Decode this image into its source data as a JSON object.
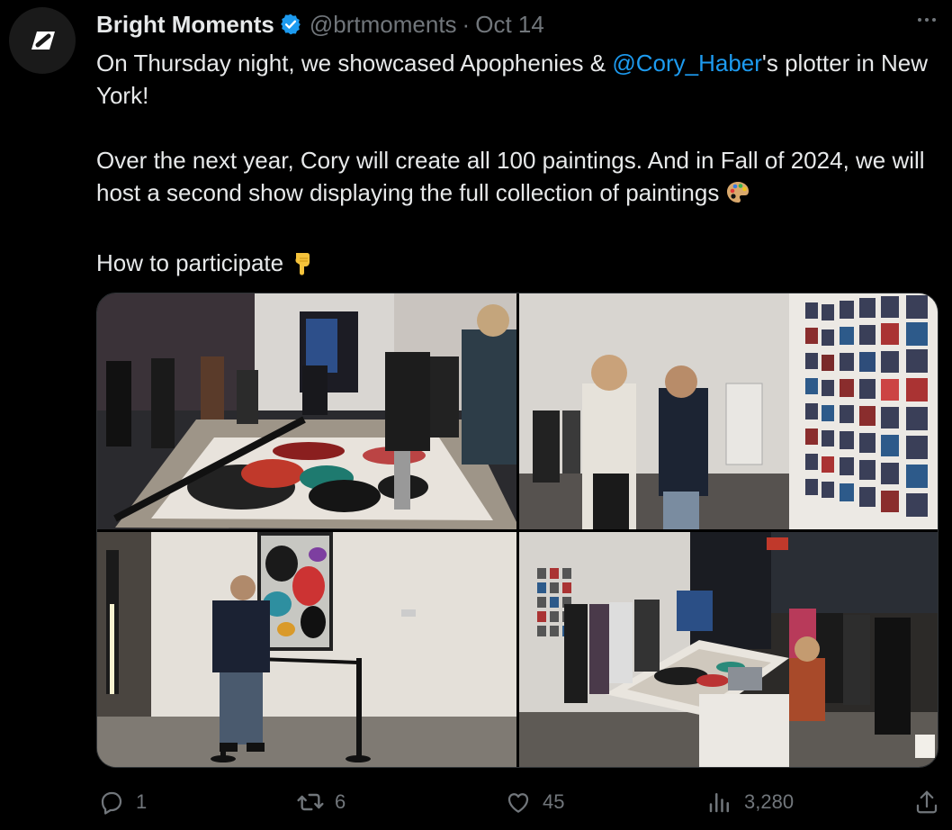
{
  "tweet": {
    "author": {
      "display_name": "Bright Moments",
      "handle": "@brtmoments",
      "separator": "·",
      "date": "Oct 14",
      "verified": true,
      "avatar_icon": "bright-moments-logo-icon"
    },
    "text": {
      "line1_prefix": "On Thursday night, we showcased Apophenies & ",
      "mention": "@Cory_Haber",
      "line1_suffix": "'s plotter in New York!",
      "paragraph2": "Over the next year, Cory will create all 100 paintings. And in Fall of 2024, we will host a second show displaying the full collection of paintings",
      "paragraph2_emoji": "artist-palette-emoji",
      "paragraph3": "How to participate",
      "paragraph3_emoji": "pointing-down-emoji"
    },
    "media": [
      {
        "icon": "photo-plotter-crowd"
      },
      {
        "icon": "photo-wall-of-prints"
      },
      {
        "icon": "photo-man-with-painting"
      },
      {
        "icon": "photo-gallery-crowd"
      }
    ],
    "actions": {
      "reply_count": "1",
      "retweet_count": "6",
      "like_count": "45",
      "views_count": "3,280"
    }
  },
  "colors": {
    "background": "#000000",
    "text": "#e7e9ea",
    "muted": "#71767b",
    "link": "#1d9bf0",
    "verified": "#1d9bf0"
  }
}
